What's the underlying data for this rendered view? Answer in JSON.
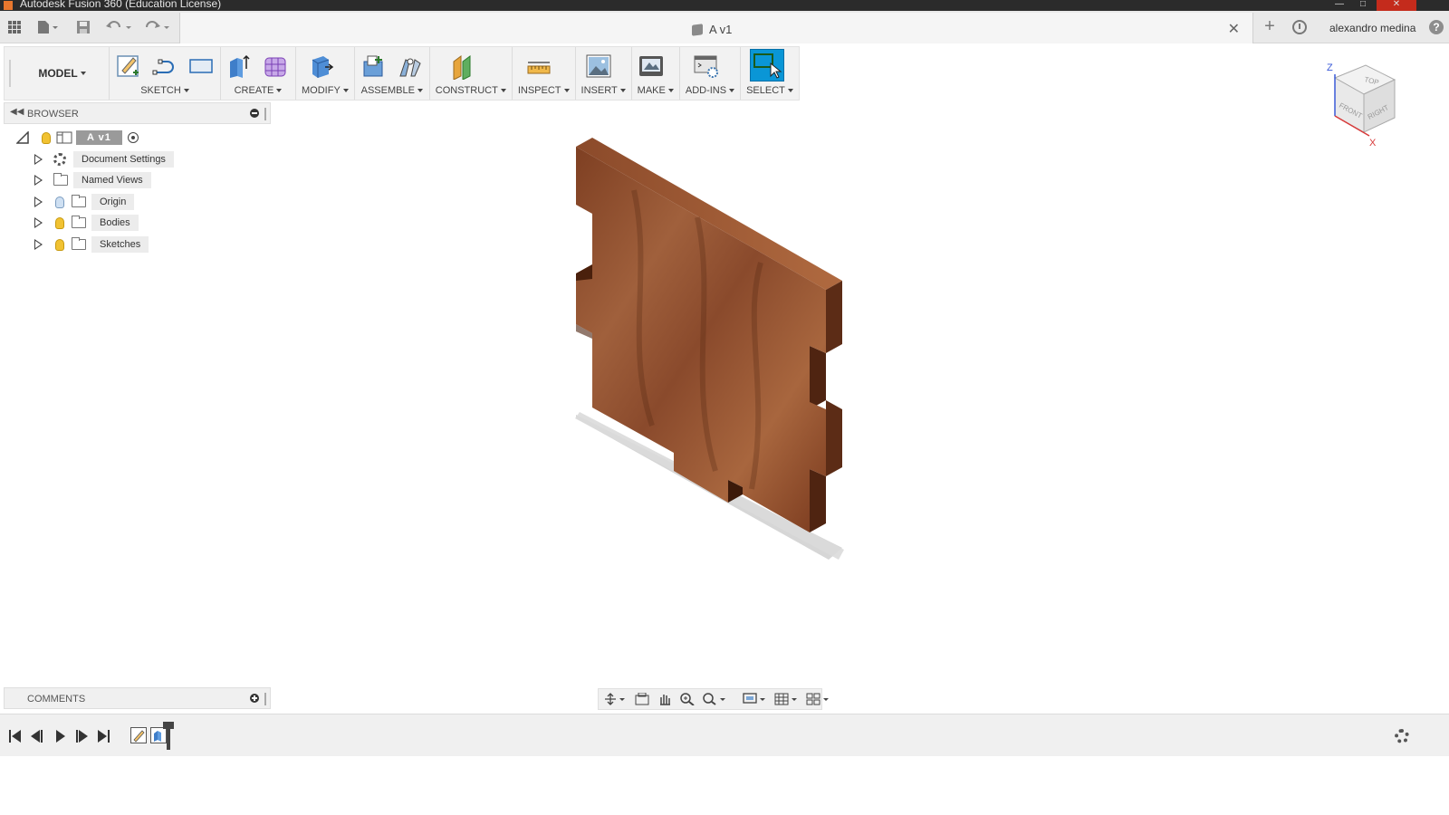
{
  "window": {
    "title": "Autodesk Fusion 360 (Education License)"
  },
  "tabbar": {
    "doc_title": "A v1",
    "username": "alexandro medina",
    "help": "?"
  },
  "toolbar": {
    "workspace": "MODEL",
    "groups": [
      {
        "label": "SKETCH"
      },
      {
        "label": "CREATE"
      },
      {
        "label": "MODIFY"
      },
      {
        "label": "ASSEMBLE"
      },
      {
        "label": "CONSTRUCT"
      },
      {
        "label": "INSPECT"
      },
      {
        "label": "INSERT"
      },
      {
        "label": "MAKE"
      },
      {
        "label": "ADD-INS"
      },
      {
        "label": "SELECT"
      }
    ]
  },
  "browser": {
    "title": "BROWSER",
    "root": "A v1",
    "items": [
      {
        "label": "Document Settings",
        "icon": "gear-icon"
      },
      {
        "label": "Named Views",
        "icon": "folder-icon"
      },
      {
        "label": "Origin",
        "icon": "folder-icon",
        "visible": false
      },
      {
        "label": "Bodies",
        "icon": "folder-icon",
        "visible": true
      },
      {
        "label": "Sketches",
        "icon": "folder-icon",
        "visible": true
      }
    ]
  },
  "comments": {
    "title": "COMMENTS"
  },
  "viewcube": {
    "faces": {
      "top": "TOP",
      "front": "FRONT",
      "right": "RIGHT"
    },
    "axes": {
      "z": "Z",
      "x": "X"
    }
  },
  "colors": {
    "accent": "#0a96d6",
    "wood": "#8b4a2b",
    "wood_dark": "#5a2a14"
  }
}
